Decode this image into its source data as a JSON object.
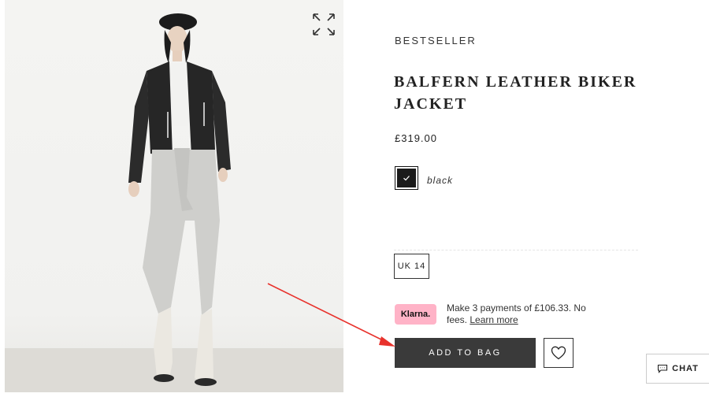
{
  "product": {
    "tag": "BESTSELLER",
    "title": "BALFERN LEATHER BIKER JACKET",
    "price": "£319.00",
    "color": {
      "name": "black",
      "swatch": "#1b1b1b",
      "selected": true
    },
    "size": {
      "selected": "UK 14"
    }
  },
  "klarna": {
    "badge": "Klarna.",
    "message": "Make 3 payments of £106.33. No fees.",
    "link": "Learn more",
    "badge_color": "#ffb3c7"
  },
  "actions": {
    "add_to_bag": "ADD TO BAG",
    "chat": "CHAT"
  },
  "icons": {
    "expand": "expand-icon",
    "check": "check-icon",
    "heart": "heart-icon",
    "chat": "chat-bubble-icon"
  },
  "colors": {
    "add_to_bag_bg": "#3a3a3a",
    "annotation_arrow": "#e8322c"
  }
}
